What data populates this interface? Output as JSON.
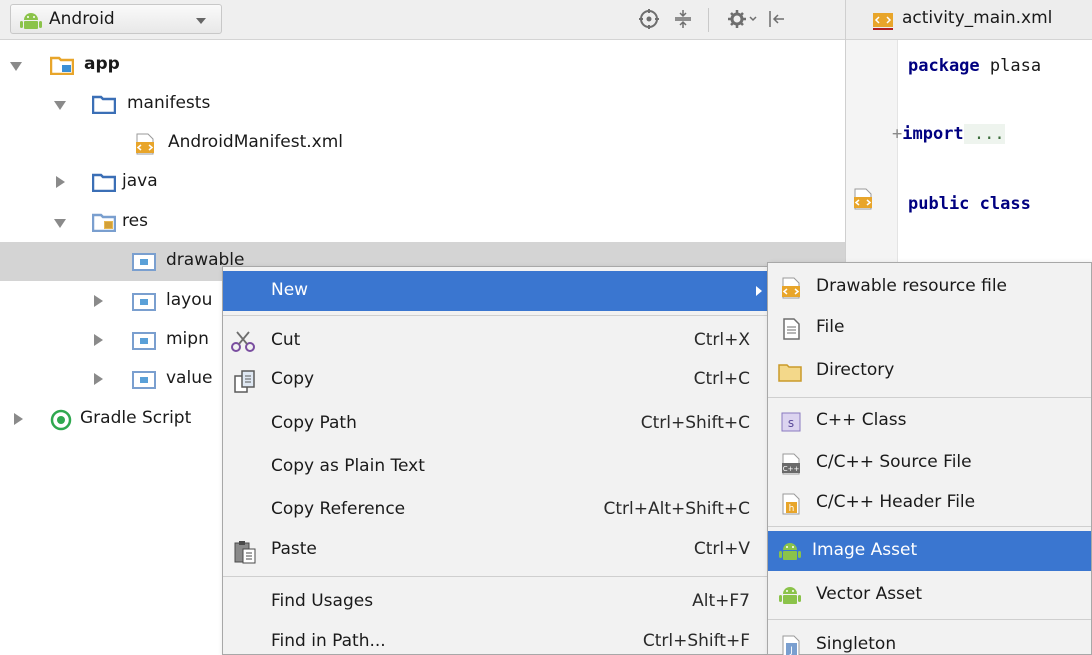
{
  "toolbar": {
    "view_selector": "Android"
  },
  "tree": {
    "app": "app",
    "manifests": "manifests",
    "android_manifest": "AndroidManifest.xml",
    "java": "java",
    "res": "res",
    "drawable": "drawable",
    "layout": "layou",
    "mipmap": "mipn",
    "values": "value",
    "gradle_scripts": "Gradle Script"
  },
  "editor": {
    "tab_label": "activity_main.xml",
    "lines": {
      "line1_kw": "package",
      "line1_rest": " plasa",
      "line2_fold": "+",
      "line2_kw": "import",
      "line2_rest": " ...",
      "line3_kw": "public class"
    }
  },
  "context_menu": {
    "new": "New",
    "cut": {
      "label": "Cut",
      "shortcut": "Ctrl+X"
    },
    "copy": {
      "label": "Copy",
      "shortcut": "Ctrl+C"
    },
    "copy_path": {
      "label": "Copy Path",
      "shortcut": "Ctrl+Shift+C"
    },
    "copy_plain": {
      "label": "Copy as Plain Text"
    },
    "copy_reference": {
      "label": "Copy Reference",
      "shortcut": "Ctrl+Alt+Shift+C"
    },
    "paste": {
      "label": "Paste",
      "shortcut": "Ctrl+V"
    },
    "find_usages": {
      "label": "Find Usages",
      "shortcut": "Alt+F7"
    },
    "find_in_path": {
      "label": "Find in Path...",
      "shortcut": "Ctrl+Shift+F"
    }
  },
  "submenu": {
    "drawable_resource": "Drawable resource file",
    "file": "File",
    "directory": "Directory",
    "cpp_class": "C++ Class",
    "c_source": "C/C++ Source File",
    "c_header": "C/C++ Header File",
    "image_asset": "Image Asset",
    "vector_asset": "Vector Asset",
    "singleton": "Singleton"
  },
  "colors": {
    "menu_highlight": "#3a76d0",
    "android_green": "#8bc34a",
    "folder_blue": "#3b6fb6",
    "res_folder_orange": "#e8b850"
  }
}
